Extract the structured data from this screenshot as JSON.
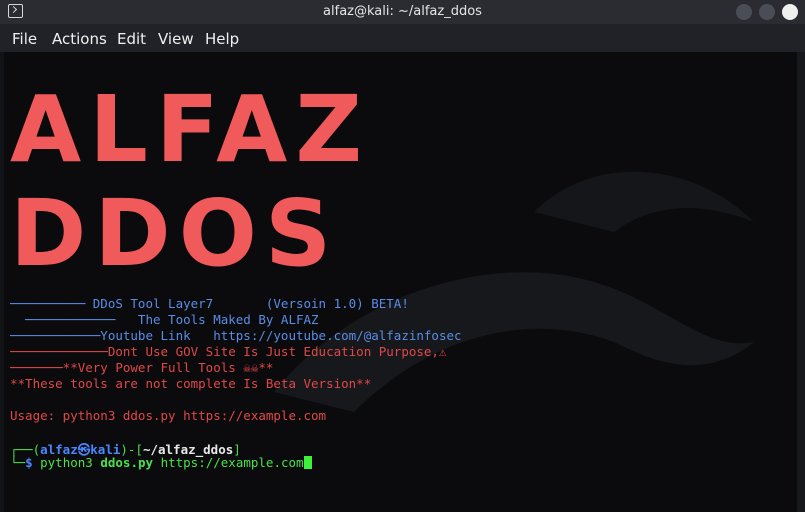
{
  "window": {
    "title": "alfaz@kali: ~/alfaz_ddos"
  },
  "menu": {
    "items": [
      "File",
      "Actions",
      "Edit",
      "View",
      "Help"
    ]
  },
  "banner": {
    "line1": "ALFAZ",
    "line2": "DDOS"
  },
  "info_lines": [
    "────────── DDoS Tool Layer7       (Versoin 1.0) BETA!",
    "  ────────────   The Tools Maked By ALFAZ",
    "────────────Youtube Link   https://youtube.com/@alfazinfosec",
    "─────────────Dont Use GOV Site Is Just Education Purpose,⚠",
    "───────**Very Power Full Tools ☠☠**",
    "**These tools are not complete Is Beta Version**"
  ],
  "usage": "Usage: python3 ddos.py https://example.com",
  "prompt": {
    "user": "alfaz",
    "host": "kali",
    "cwd": "~/alfaz_ddos",
    "command": "python3",
    "script": "ddos.py",
    "arg": "https://example.com"
  },
  "colors": {
    "banner": "#f05a5a",
    "info": "#5b8de6",
    "warning": "#e04848",
    "prompt": "#4be04b"
  }
}
